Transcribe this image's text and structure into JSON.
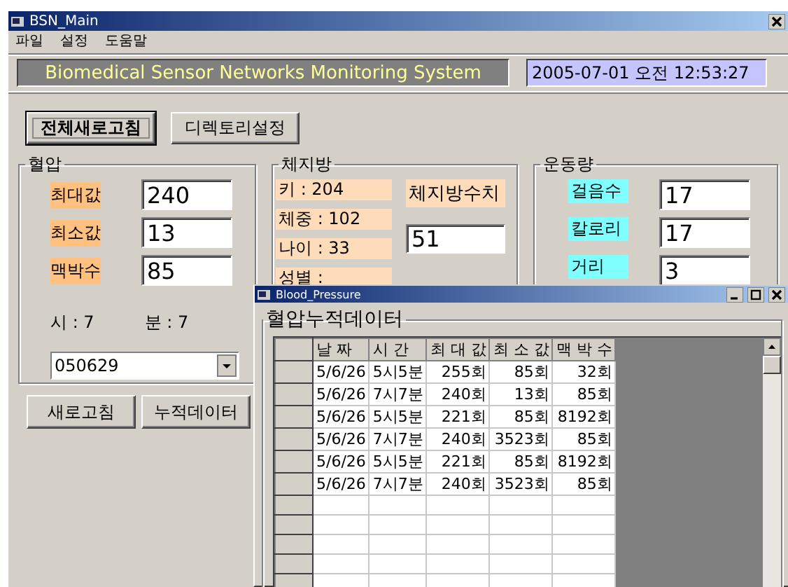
{
  "window": {
    "title": "BSN_Main"
  },
  "menu": [
    "파일",
    "설정",
    "도움말"
  ],
  "header": {
    "title": "Biomedical Sensor Networks Monitoring System",
    "datetime": "2005-07-01 오전 12:53:27"
  },
  "top_buttons": [
    {
      "label": "전체새로고침",
      "focused": true
    },
    {
      "label": "디렉토리설정",
      "focused": false
    }
  ],
  "blood_pressure": {
    "title": "혈압",
    "fields": [
      {
        "label": "최대값",
        "value": "240"
      },
      {
        "label": "최소값",
        "value": "13"
      },
      {
        "label": "맥박수",
        "value": "85"
      }
    ],
    "hour": "시 : 7",
    "minute": "분 : 7",
    "date_combo": "050629"
  },
  "bottom_buttons": [
    "새로고침",
    "누적데이터"
  ],
  "body_fat": {
    "title": "체지방",
    "info": [
      "키 : 204",
      "체중 : 102",
      "나이 : 33",
      "성별 :"
    ],
    "value_label": "체지방수치",
    "value": "51"
  },
  "exercise": {
    "title": "운동량",
    "fields": [
      {
        "label": "걸음수",
        "value": "17"
      },
      {
        "label": "칼로리",
        "value": "17"
      },
      {
        "label": "거리",
        "value": "3"
      }
    ]
  },
  "child_window": {
    "title": "Blood_Pressure",
    "group_title": "혈압누적데이터",
    "table": {
      "columns": [
        "날 짜",
        "시 간",
        "최 대 값",
        "최 소 값",
        "맥 박 수"
      ],
      "rows": [
        [
          "5/6/26",
          "5시5분",
          "255회",
          "85회",
          "32회"
        ],
        [
          "5/6/26",
          "7시7분",
          "240회",
          "13회",
          "85회"
        ],
        [
          "5/6/26",
          "5시5분",
          "221회",
          "85회",
          "8192회"
        ],
        [
          "5/6/26",
          "7시7분",
          "240회",
          "3523회",
          "85회"
        ],
        [
          "5/6/26",
          "5시5분",
          "221회",
          "85회",
          "8192회"
        ],
        [
          "5/6/26",
          "7시7분",
          "240회",
          "3523회",
          "85회"
        ]
      ]
    }
  }
}
